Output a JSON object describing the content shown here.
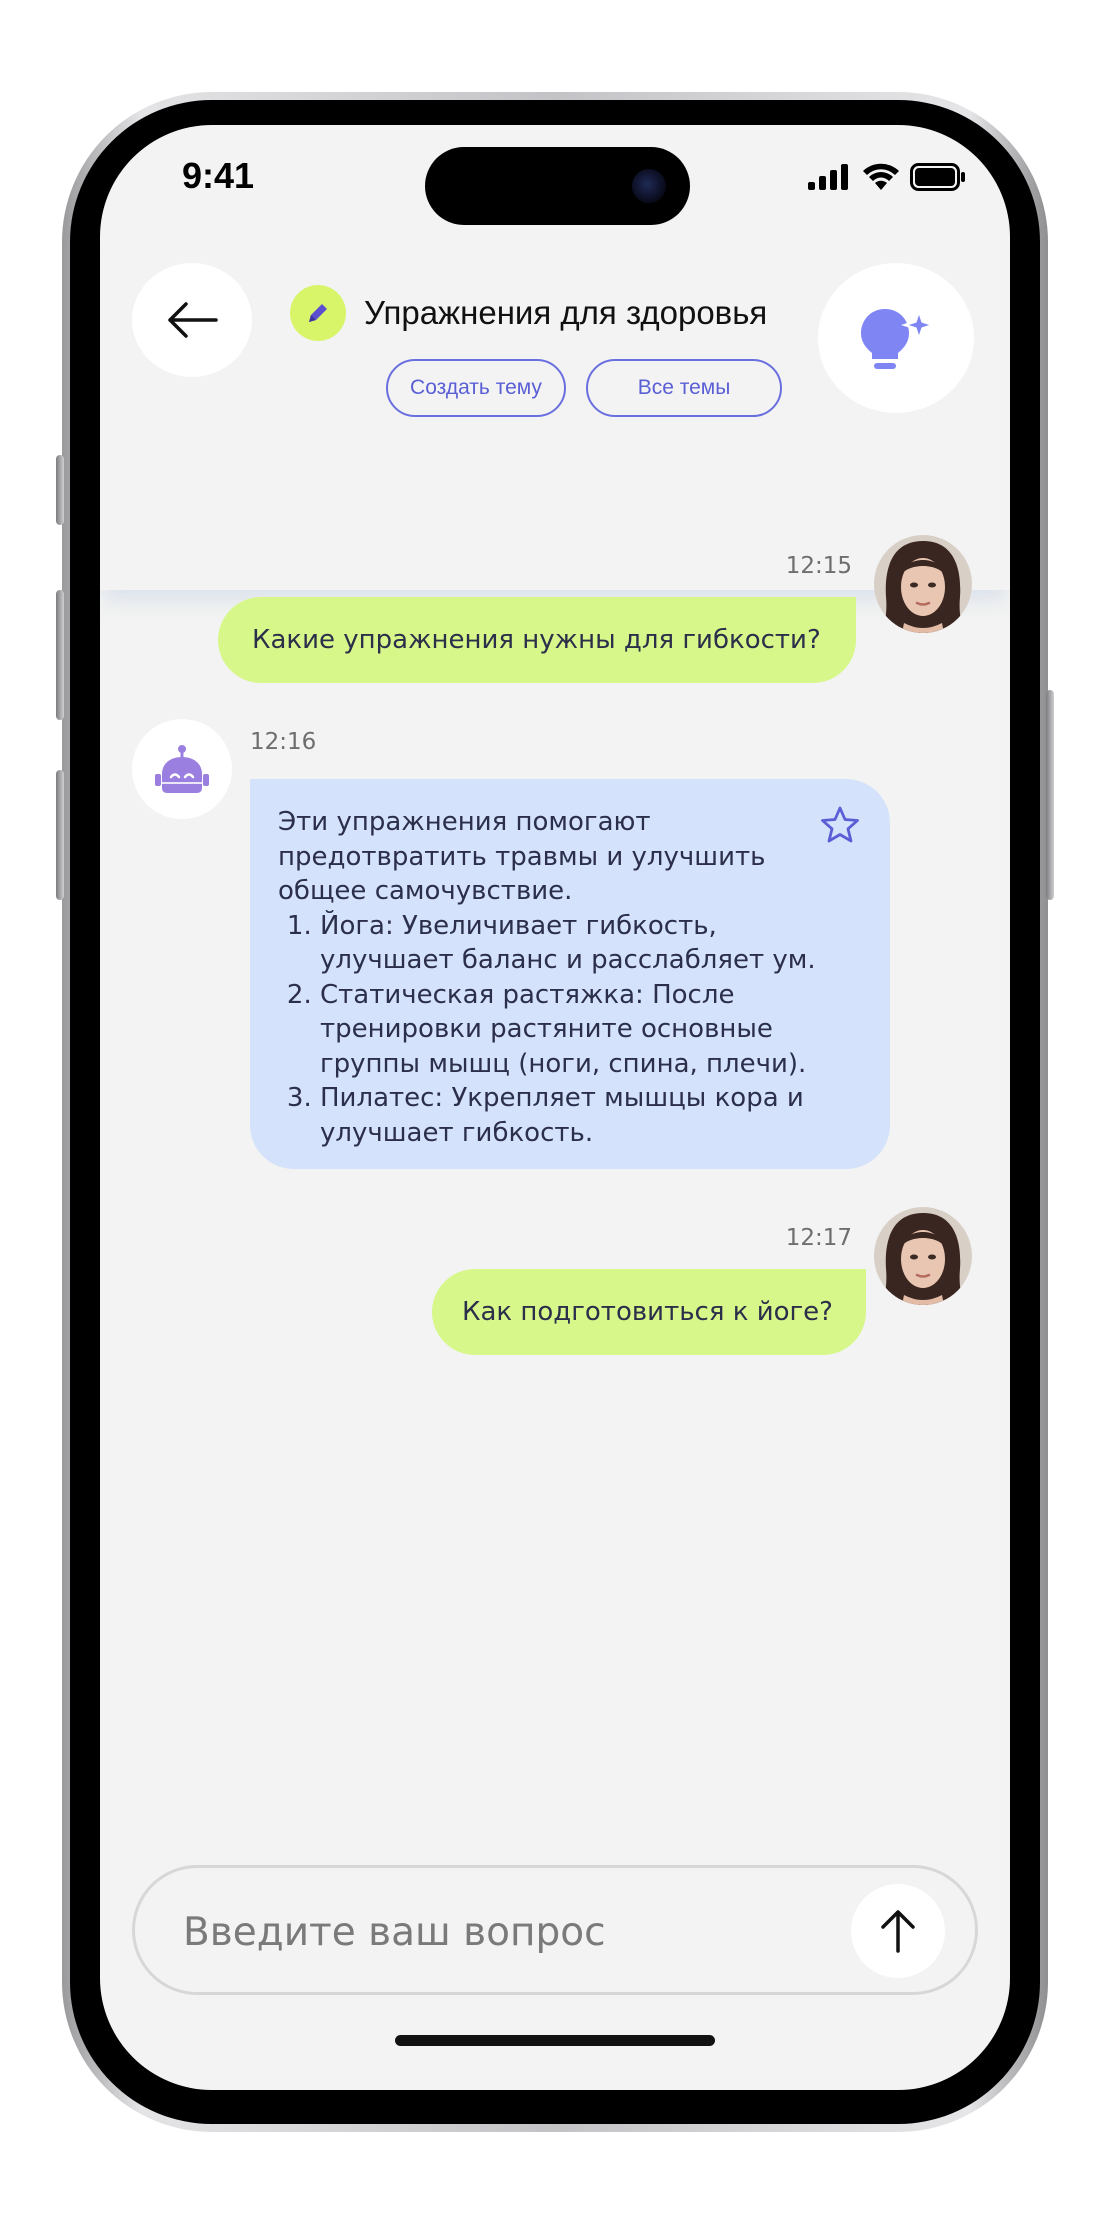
{
  "status_bar": {
    "time": "9:41",
    "icons": [
      "cellular-signal-icon",
      "wifi-icon",
      "battery-icon"
    ]
  },
  "header": {
    "back_icon": "arrow-left-icon",
    "edit_icon": "pencil-icon",
    "title": "Упражнения для здоровья",
    "create_topic_label": "Создать тему",
    "all_topics_label": "Все темы",
    "idea_icon": "lightbulb-sparkle-icon"
  },
  "messages": [
    {
      "role": "user",
      "time": "12:15",
      "text": "Какие упражнения нужны для гибкости?"
    },
    {
      "role": "bot",
      "time": "12:16",
      "intro": "Эти упражнения помогают предотвратить травмы и улучшить общее самочувствие.",
      "items": [
        "Йога: Увеличивает гибкость, улучшает баланс и расслабляет ум.",
        "Статическая растяжка: После тренировки растяните основные группы мышц (ноги, спина, плечи).",
        "Пилатес: Укрепляет мышцы кора и улучшает гибкость."
      ],
      "favorite_icon": "star-outline-icon"
    },
    {
      "role": "user",
      "time": "12:17",
      "text": "Как подготовиться к йоге?"
    }
  ],
  "composer": {
    "placeholder": "Введите ваш вопрос",
    "value": "",
    "send_icon": "arrow-up-icon"
  },
  "colors": {
    "user_bubble": "#d8f78a",
    "bot_bubble": "#d4e2fb",
    "accent": "#6a6fdf",
    "edit_badge": "#d8f56a",
    "bot_icon": "#9b7fe0",
    "background": "#f2f3f2"
  }
}
